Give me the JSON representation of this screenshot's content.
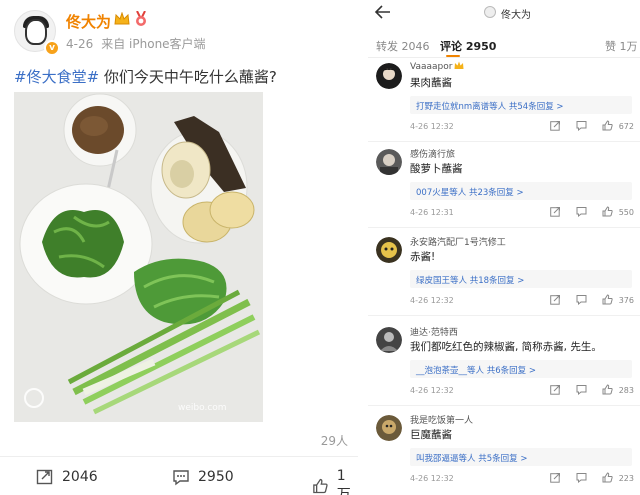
{
  "post": {
    "username": "佟大为",
    "date": "4-26",
    "source": "来自 iPhone客户端",
    "hashtag": "#佟大食堂#",
    "text": " 你们今天中午吃什么蘸酱?",
    "watermark": "weibo.com",
    "likers_count": "29人",
    "actions": {
      "repost": "2046",
      "comment": "2950",
      "like": "1万"
    }
  },
  "comments_page": {
    "title": "佟大为",
    "tabs": [
      {
        "label": "转发 2046"
      },
      {
        "label": "评论 2950"
      },
      {
        "label": "赞 1万"
      }
    ],
    "comments": [
      {
        "user": "Vaaaapor",
        "text": "果肉蘸酱",
        "replies": "打野走位就nm离谱等人",
        "replies_count": "共54条回复 >",
        "time": "4-26 12:32",
        "likes": "672",
        "avatar_color": "#1c1c1c"
      },
      {
        "user": "感伤滴行旅",
        "text": "酸萝卜蘸酱",
        "replies": "007火星等人",
        "replies_count": "共23条回复 >",
        "time": "4-26 12:31",
        "likes": "550",
        "avatar_color": "#5a5a5a"
      },
      {
        "user": "永安路汽配厂1号汽修工",
        "text": "赤酱!",
        "replies": "绿皮国王等人",
        "replies_count": "共18条回复 >",
        "time": "4-26 12:32",
        "likes": "376",
        "avatar_color": "#3a3220"
      },
      {
        "user": "迪达·范特西",
        "text": "我们都吃红色的辣椒酱, 简称赤酱, 先生。",
        "replies": "__泡泡茶壶__等人",
        "replies_count": "共6条回复 >",
        "time": "4-26 12:32",
        "likes": "283",
        "avatar_color": "#444444"
      },
      {
        "user": "我是吃饭第一人",
        "text": "巨魔蘸酱",
        "replies": "叫我邵逼逼等人",
        "replies_count": "共5条回复 >",
        "time": "4-26 12:32",
        "likes": "223",
        "avatar_color": "#6b5a3a"
      }
    ]
  },
  "colors": {
    "accent": "#f08300",
    "link": "#3b6fc6"
  }
}
